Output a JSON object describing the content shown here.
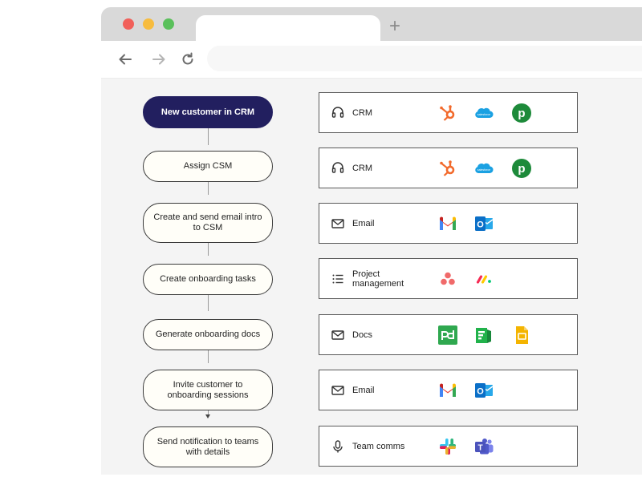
{
  "browser": {
    "new_tab_glyph": "+",
    "nav_icons": [
      "back-arrow-icon",
      "forward-arrow-icon",
      "reload-icon"
    ]
  },
  "workflow": {
    "steps": [
      {
        "label": "New customer in CRM",
        "highlight": true
      },
      {
        "label": "Assign CSM"
      },
      {
        "label": "Create and send email intro to CSM"
      },
      {
        "label": "Create onboarding tasks"
      },
      {
        "label": "Generate onboarding docs"
      },
      {
        "label": "Invite customer to onboarding sessions"
      },
      {
        "label": "Send notification to teams with details"
      }
    ]
  },
  "tools": [
    {
      "category": "CRM",
      "icon": "headset-icon",
      "apps": [
        "hubspot-logo",
        "salesforce-logo",
        "pipedrive-logo"
      ]
    },
    {
      "category": "CRM",
      "icon": "headset-icon",
      "apps": [
        "hubspot-logo",
        "salesforce-logo",
        "pipedrive-logo"
      ]
    },
    {
      "category": "Email",
      "icon": "envelope-icon",
      "apps": [
        "gmail-logo",
        "outlook-logo"
      ]
    },
    {
      "category": "Project management",
      "icon": "list-icon",
      "apps": [
        "asana-logo",
        "monday-logo"
      ]
    },
    {
      "category": "Docs",
      "icon": "envelope-icon",
      "apps": [
        "pandadoc-logo",
        "formstack-logo",
        "google-slides-logo"
      ]
    },
    {
      "category": "Email",
      "icon": "envelope-icon",
      "apps": [
        "gmail-logo",
        "outlook-logo"
      ]
    },
    {
      "category": "Team comms",
      "icon": "microphone-icon",
      "apps": [
        "slack-logo",
        "microsoft-teams-logo"
      ]
    }
  ],
  "logo_text": {
    "salesforce": "salesforce",
    "pipedrive": "p",
    "outlook": "O",
    "teams": "T"
  },
  "colors": {
    "primary_step": "#221f5f",
    "hubspot": "#f26a2c",
    "salesforce": "#1ba1e2",
    "pipedrive": "#1d8a3a",
    "asana": "#f06a6a",
    "pandadoc": "#2fa84f",
    "formstack": "#21b24b",
    "google_slides": "#f4b400",
    "outlook": "#0b6fc7",
    "teams": "#4b53bc"
  }
}
